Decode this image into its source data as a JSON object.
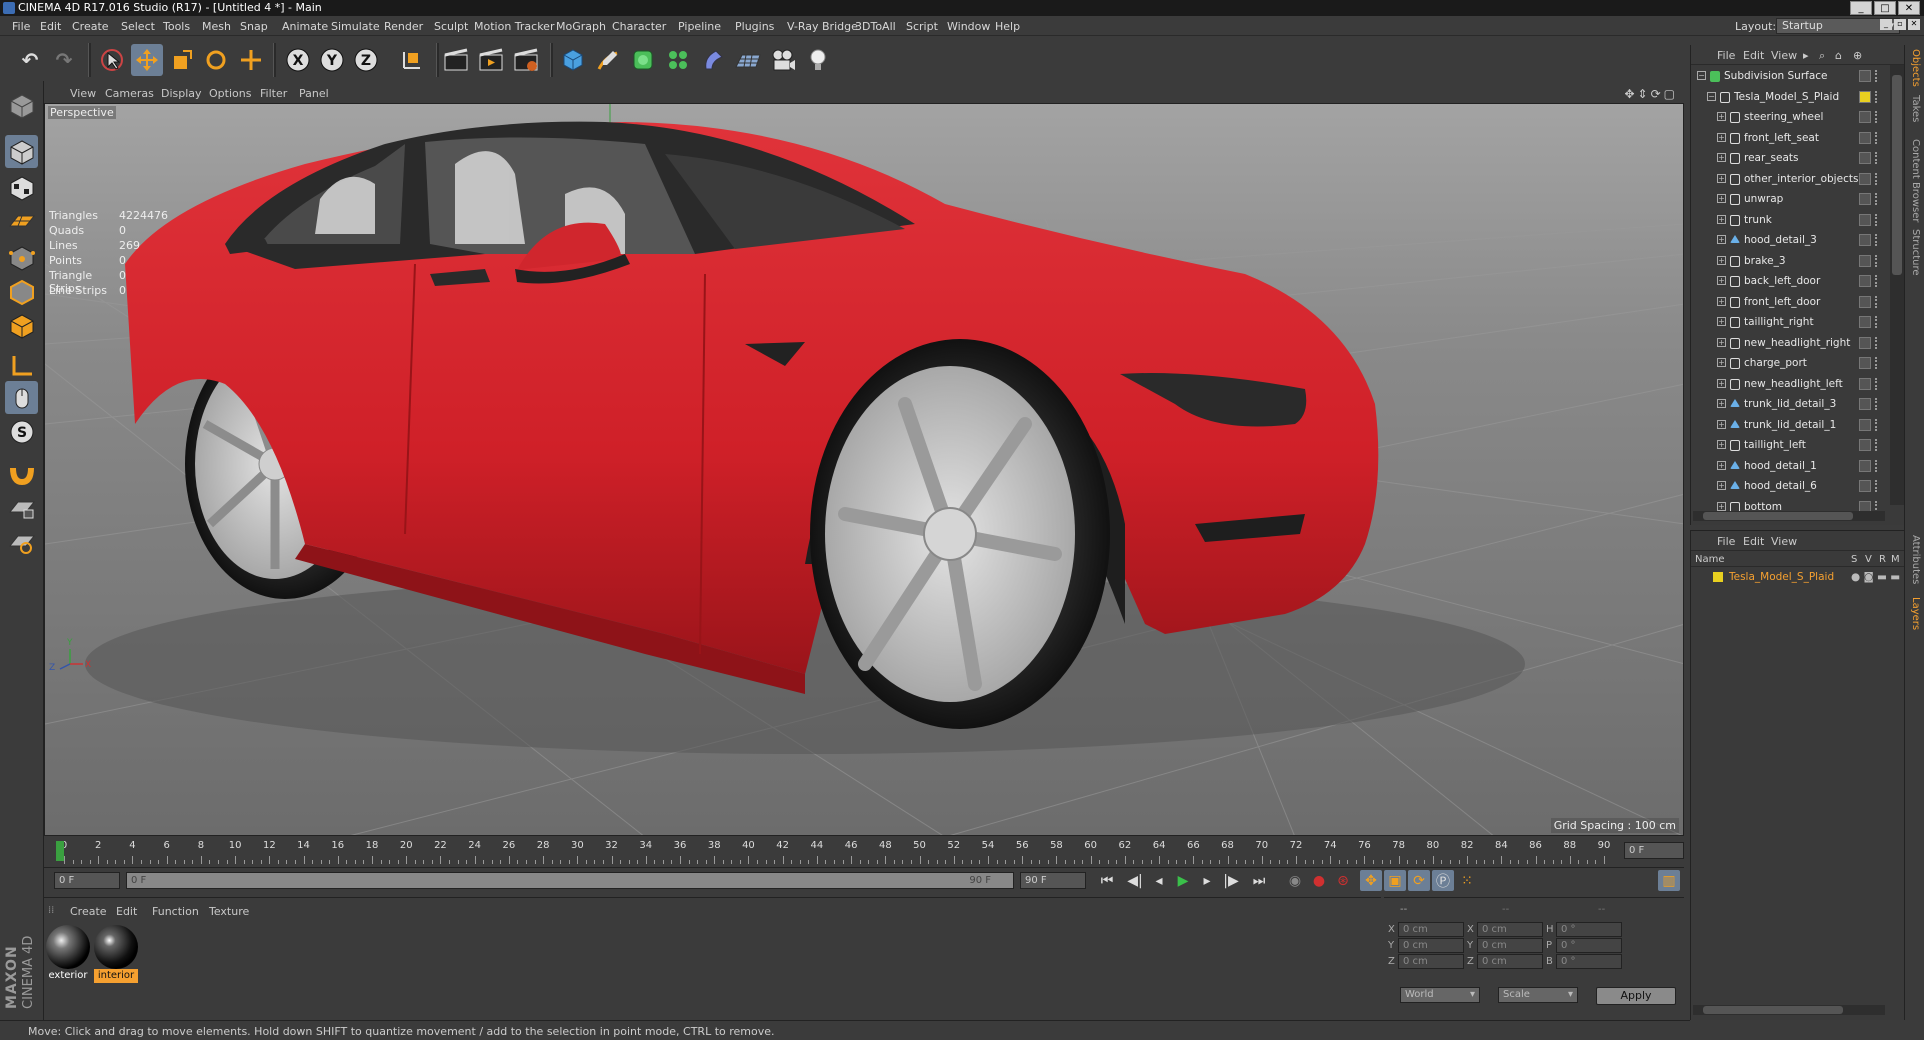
{
  "window": {
    "title": "CINEMA 4D R17.016 Studio (R17) - [Untitled 4 *] - Main"
  },
  "menu": [
    "File",
    "Edit",
    "Create",
    "Select",
    "Tools",
    "Mesh",
    "Snap",
    "Animate",
    "Simulate",
    "Render",
    "Sculpt",
    "Motion Tracker",
    "MoGraph",
    "Character",
    "Pipeline",
    "Plugins",
    "V-Ray Bridge",
    "3DToAll",
    "Script",
    "Window",
    "Help"
  ],
  "layout": {
    "label": "Layout:",
    "value": "Startup"
  },
  "toolbar": {
    "x_label": "X",
    "y_label": "Y",
    "z_label": "Z"
  },
  "viewport": {
    "menu": [
      "View",
      "Cameras",
      "Display",
      "Options",
      "Filter",
      "Panel"
    ],
    "label": "Perspective",
    "stats": [
      [
        "Triangles",
        "4224476"
      ],
      [
        "Quads",
        "0"
      ],
      [
        "Lines",
        "269"
      ],
      [
        "Points",
        "0"
      ],
      [
        "Triangle Strips",
        "0"
      ],
      [
        "Line Strips",
        "0"
      ]
    ],
    "grid_spacing": "Grid Spacing : 100 cm",
    "axis": {
      "y": "Y",
      "z": "Z",
      "x": "X"
    }
  },
  "timeline": {
    "ticks": [
      "0",
      "2",
      "4",
      "6",
      "8",
      "10",
      "12",
      "14",
      "16",
      "18",
      "20",
      "22",
      "24",
      "26",
      "28",
      "30",
      "32",
      "34",
      "36",
      "38",
      "40",
      "42",
      "44",
      "46",
      "48",
      "50",
      "52",
      "54",
      "56",
      "58",
      "60",
      "62",
      "64",
      "66",
      "68",
      "70",
      "72",
      "74",
      "76",
      "78",
      "80",
      "82",
      "84",
      "86",
      "88",
      "90"
    ],
    "current_frame": "0 F",
    "start": "0 F",
    "range_start": "0 F",
    "range_end": "90 F",
    "end": "90 F"
  },
  "materials": {
    "menu": [
      "Create",
      "Edit",
      "Function",
      "Texture"
    ],
    "items": [
      {
        "name": "exterior"
      },
      {
        "name": "interior"
      }
    ]
  },
  "coords": {
    "pos": [
      [
        "X",
        "0 cm"
      ],
      [
        "Y",
        "0 cm"
      ],
      [
        "Z",
        "0 cm"
      ]
    ],
    "size": [
      [
        "X",
        "0 cm"
      ],
      [
        "Y",
        "0 cm"
      ],
      [
        "Z",
        "0 cm"
      ]
    ],
    "rot": [
      [
        "H",
        "0 °"
      ],
      [
        "P",
        "0 °"
      ],
      [
        "B",
        "0 °"
      ]
    ],
    "mode_world": "World",
    "mode_scale": "Scale",
    "apply": "Apply",
    "dashes": "--"
  },
  "status": "Move: Click and drag to move elements. Hold down SHIFT to quantize movement / add to the selection in point mode, CTRL to remove.",
  "objects": {
    "menu": [
      "File",
      "Edit",
      "View"
    ],
    "items": [
      {
        "name": "Subdivision Surface",
        "depth": 0,
        "type": "subdiv"
      },
      {
        "name": "Tesla_Model_S_Plaid",
        "depth": 1,
        "type": "null"
      },
      {
        "name": "steering_wheel",
        "depth": 2,
        "type": "null"
      },
      {
        "name": "front_left_seat",
        "depth": 2,
        "type": "null"
      },
      {
        "name": "rear_seats",
        "depth": 2,
        "type": "null"
      },
      {
        "name": "other_interior_objects",
        "depth": 2,
        "type": "null"
      },
      {
        "name": "unwrap",
        "depth": 2,
        "type": "null"
      },
      {
        "name": "trunk",
        "depth": 2,
        "type": "null"
      },
      {
        "name": "hood_detail_3",
        "depth": 2,
        "type": "poly"
      },
      {
        "name": "brake_3",
        "depth": 2,
        "type": "null"
      },
      {
        "name": "back_left_door",
        "depth": 2,
        "type": "null"
      },
      {
        "name": "front_left_door",
        "depth": 2,
        "type": "null"
      },
      {
        "name": "taillight_right",
        "depth": 2,
        "type": "null"
      },
      {
        "name": "new_headlight_right",
        "depth": 2,
        "type": "null"
      },
      {
        "name": "charge_port",
        "depth": 2,
        "type": "null"
      },
      {
        "name": "new_headlight_left",
        "depth": 2,
        "type": "null"
      },
      {
        "name": "trunk_lid_detail_3",
        "depth": 2,
        "type": "poly"
      },
      {
        "name": "trunk_lid_detail_1",
        "depth": 2,
        "type": "poly"
      },
      {
        "name": "taillight_left",
        "depth": 2,
        "type": "null"
      },
      {
        "name": "hood_detail_1",
        "depth": 2,
        "type": "poly"
      },
      {
        "name": "hood_detail_6",
        "depth": 2,
        "type": "poly"
      },
      {
        "name": "bottom",
        "depth": 2,
        "type": "null"
      }
    ]
  },
  "layers": {
    "menu": [
      "File",
      "Edit",
      "View"
    ],
    "headers": [
      "Name",
      "S",
      "V",
      "R",
      "M"
    ],
    "items": [
      {
        "name": "Tesla_Model_S_Plaid"
      }
    ]
  },
  "sidetabs": {
    "top": [
      "Objects",
      "Takes",
      "Content Browser",
      "Structure"
    ],
    "bottom": [
      "Attributes",
      "Layers"
    ]
  },
  "colors": {
    "accent": "#f5a030",
    "selected": "#6c7f96",
    "car": "#d8262c",
    "layer": "#e8d020"
  }
}
